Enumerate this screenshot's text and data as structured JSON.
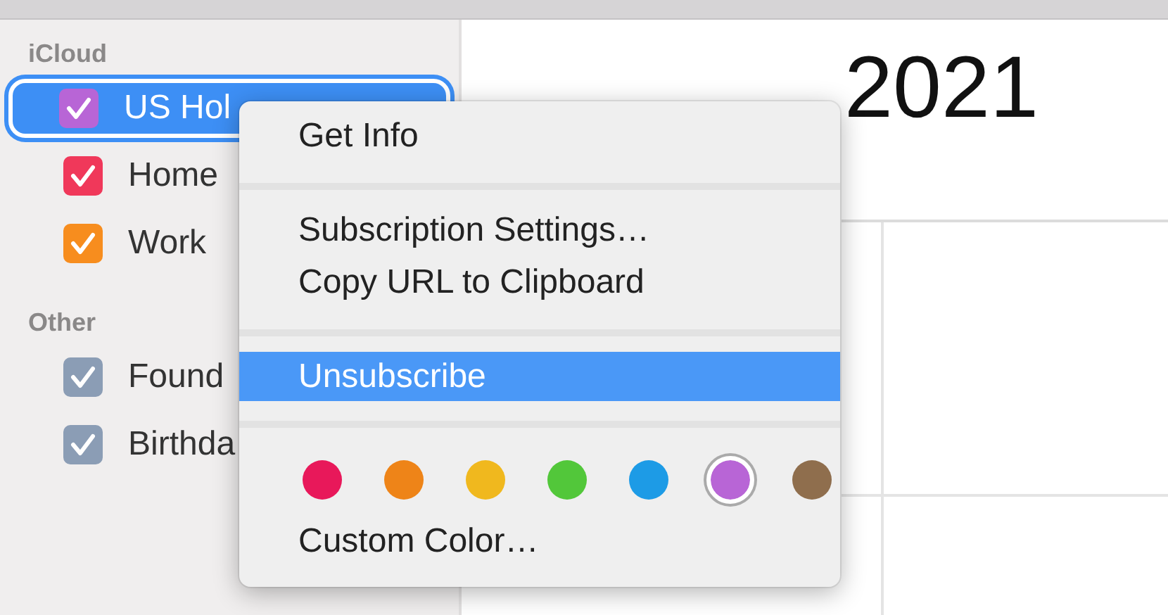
{
  "sidebar": {
    "sections": [
      {
        "title": "iCloud",
        "calendars": [
          {
            "name": "US Hol",
            "color": "#b865d6",
            "checked": true,
            "selected": true
          },
          {
            "name": "Home",
            "color": "#f0385a",
            "checked": true,
            "selected": false
          },
          {
            "name": "Work",
            "color": "#f78d1e",
            "checked": true,
            "selected": false
          }
        ]
      },
      {
        "title": "Other",
        "calendars": [
          {
            "name": "Found",
            "color": "#8b9db5",
            "checked": true,
            "selected": false
          },
          {
            "name": "Birthda",
            "color": "#8b9db5",
            "checked": true,
            "selected": false
          }
        ]
      }
    ]
  },
  "main": {
    "year": "2021"
  },
  "context_menu": {
    "items": [
      {
        "kind": "item",
        "label": "Get Info",
        "selected": false
      },
      {
        "kind": "separator"
      },
      {
        "kind": "item",
        "label": "Subscription Settings…",
        "selected": false
      },
      {
        "kind": "item",
        "label": "Copy URL to Clipboard",
        "selected": false
      },
      {
        "kind": "separator"
      },
      {
        "kind": "item",
        "label": "Unsubscribe",
        "selected": true
      },
      {
        "kind": "separator"
      },
      {
        "kind": "colors",
        "colors": [
          {
            "color": "#e8185a",
            "selected": false
          },
          {
            "color": "#ee8418",
            "selected": false
          },
          {
            "color": "#f0b81e",
            "selected": false
          },
          {
            "color": "#52c73a",
            "selected": false
          },
          {
            "color": "#1d9be6",
            "selected": false
          },
          {
            "color": "#b865d6",
            "selected": true
          },
          {
            "color": "#8f6e4d",
            "selected": false
          }
        ]
      },
      {
        "kind": "item",
        "label": "Custom Color…",
        "selected": false
      }
    ]
  }
}
